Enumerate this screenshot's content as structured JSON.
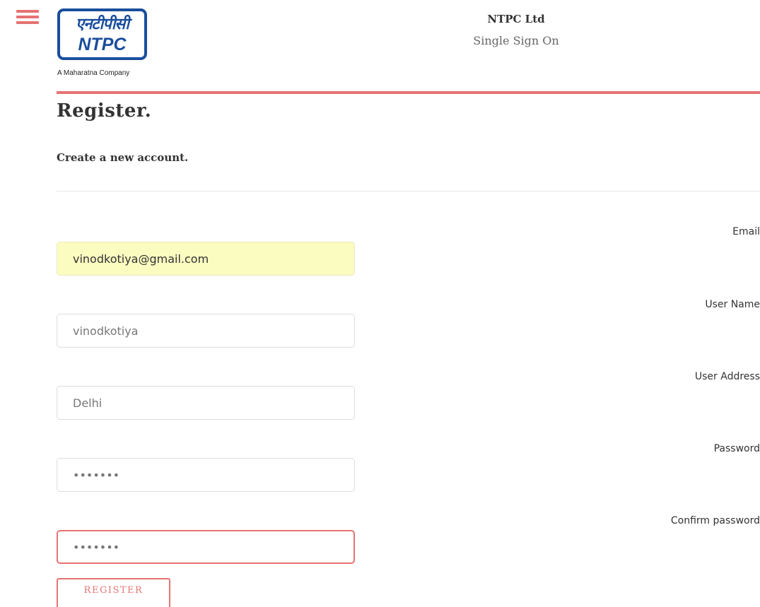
{
  "header": {
    "logo": {
      "hindi_text": "एनटीपीसी",
      "english_text": "NTPC",
      "tagline": "A Maharatna Company"
    },
    "site_title": "NTPC Ltd",
    "site_subtitle": "Single Sign On"
  },
  "page": {
    "title": "Register.",
    "subtitle": "Create a new account."
  },
  "form": {
    "fields": [
      {
        "label": "Email",
        "value": "vinodkotiya@gmail.com",
        "state": "autofilled"
      },
      {
        "label": "User Name",
        "value": "vinodkotiya"
      },
      {
        "label": "User Address",
        "value": "Delhi"
      },
      {
        "label": "Password",
        "value": "•••••••"
      },
      {
        "label": "Confirm password",
        "value": "•••••••",
        "state": "focused"
      }
    ],
    "submit_label": "REGISTER"
  },
  "colors": {
    "accent": "#e57373",
    "brand_blue": "#1a4e9c",
    "autofill_background": "#fafcc0"
  },
  "icons": {
    "menu": "hamburger-menu-icon"
  }
}
